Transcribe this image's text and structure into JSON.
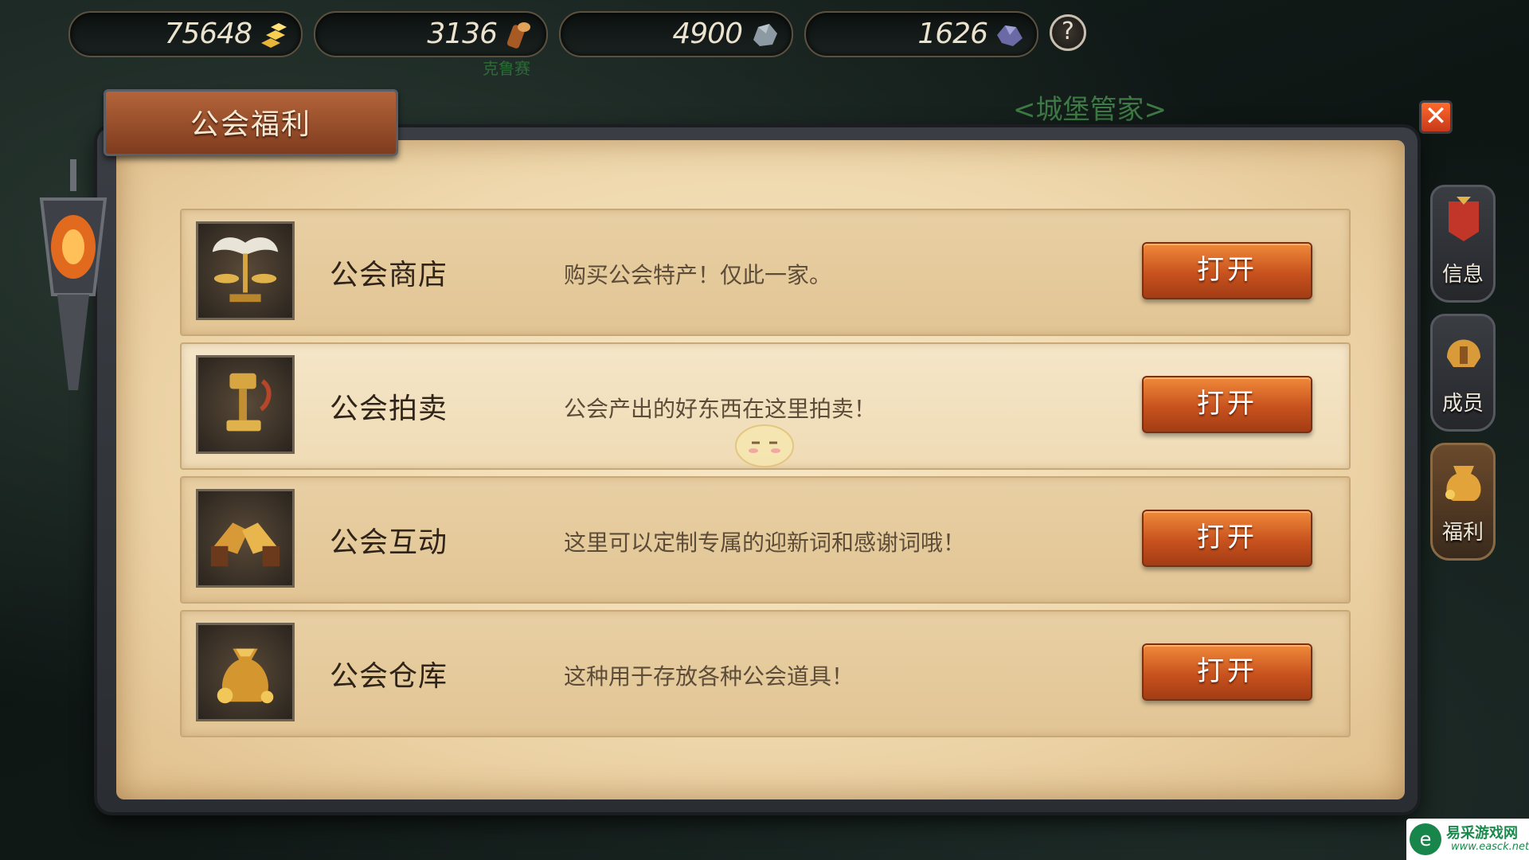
{
  "resources": [
    {
      "name": "gold",
      "value": "75648",
      "icon": "gold-bars-icon"
    },
    {
      "name": "wood",
      "value": "3136",
      "icon": "wood-log-icon"
    },
    {
      "name": "stone",
      "value": "4900",
      "icon": "stone-icon"
    },
    {
      "name": "ore",
      "value": "1626",
      "icon": "purple-ore-icon"
    }
  ],
  "help_symbol": "?",
  "background_npc_labels": {
    "small": "克鲁赛",
    "large": "<城堡管家>"
  },
  "panel": {
    "title": "公会福利",
    "close_symbol": "✕"
  },
  "rows": [
    {
      "name": "公会商店",
      "desc": "购买公会特产！仅此一家。",
      "button": "打开",
      "icon": "winged-scales-icon"
    },
    {
      "name": "公会拍卖",
      "desc": "公会产出的好东西在这里拍卖！",
      "button": "打开",
      "icon": "auction-gavel-icon"
    },
    {
      "name": "公会互动",
      "desc": "这里可以定制专属的迎新词和感谢词哦！",
      "button": "打开",
      "icon": "handshake-icon"
    },
    {
      "name": "公会仓库",
      "desc": "这种用于存放各种公会道具！",
      "button": "打开",
      "icon": "treasure-bag-icon"
    }
  ],
  "side_tabs": [
    {
      "label": "信息",
      "icon": "guild-banner-icon"
    },
    {
      "label": "成员",
      "icon": "helmet-icon"
    },
    {
      "label": "福利",
      "icon": "treasure-icon",
      "active": true
    }
  ],
  "watermark": {
    "logo": "e",
    "title": "易采游戏网",
    "url": "www.easck.net"
  },
  "colors": {
    "button_orange": "#d8622a",
    "parchment": "#efd8ad",
    "frame": "#2f3237"
  }
}
